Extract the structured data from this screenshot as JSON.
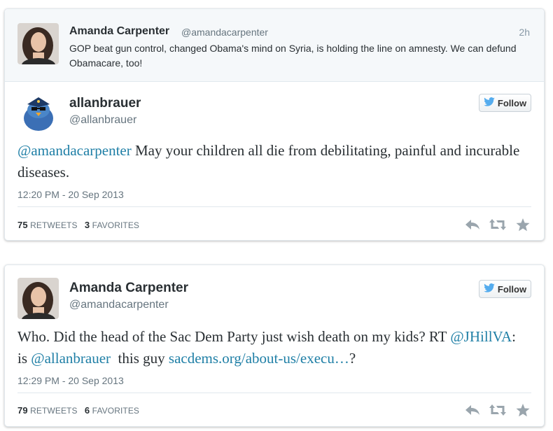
{
  "colors": {
    "link": "#1f7fa6",
    "icon_gray": "#9aa5ad",
    "twitter_blue": "#55acee"
  },
  "tweet1": {
    "parent": {
      "name": "Amanda Carpenter",
      "handle": "@amandacarpenter",
      "time": "2h",
      "text": "GOP beat gun control, changed Obama's mind on Syria, is holding the line on amnesty. We can defund Obamacare, too!"
    },
    "author": {
      "display_name": "allanbrauer",
      "screen_name": "@allanbrauer"
    },
    "follow_label": "Follow",
    "text_mention": "@amandacarpenter",
    "text_rest": " May your children all die from debilitating, painful and incurable diseases.",
    "timestamp": "12:20 PM - 20 Sep 2013",
    "retweets_count": "75",
    "retweets_label": "RETWEETS",
    "favorites_count": "3",
    "favorites_label": "FAVORITES"
  },
  "tweet2": {
    "author": {
      "display_name": "Amanda Carpenter",
      "screen_name": "@amandacarpenter"
    },
    "follow_label": "Follow",
    "text_part1": "Who. Did the head of the Sac Dem Party just wish death on my kids? RT ",
    "text_mention1": "@JHillVA",
    "text_part2": ": is ",
    "text_mention2": "@allanbrauer",
    "text_part3": "  this guy ",
    "text_link": "sacdems.org/about-us/execu…",
    "text_part4": "?",
    "timestamp": "12:29 PM - 20 Sep 2013",
    "retweets_count": "79",
    "retweets_label": "RETWEETS",
    "favorites_count": "6",
    "favorites_label": "FAVORITES"
  },
  "icons": {
    "reply": "reply-icon",
    "retweet": "retweet-icon",
    "favorite": "star-icon",
    "bird": "twitter-bird-icon"
  }
}
